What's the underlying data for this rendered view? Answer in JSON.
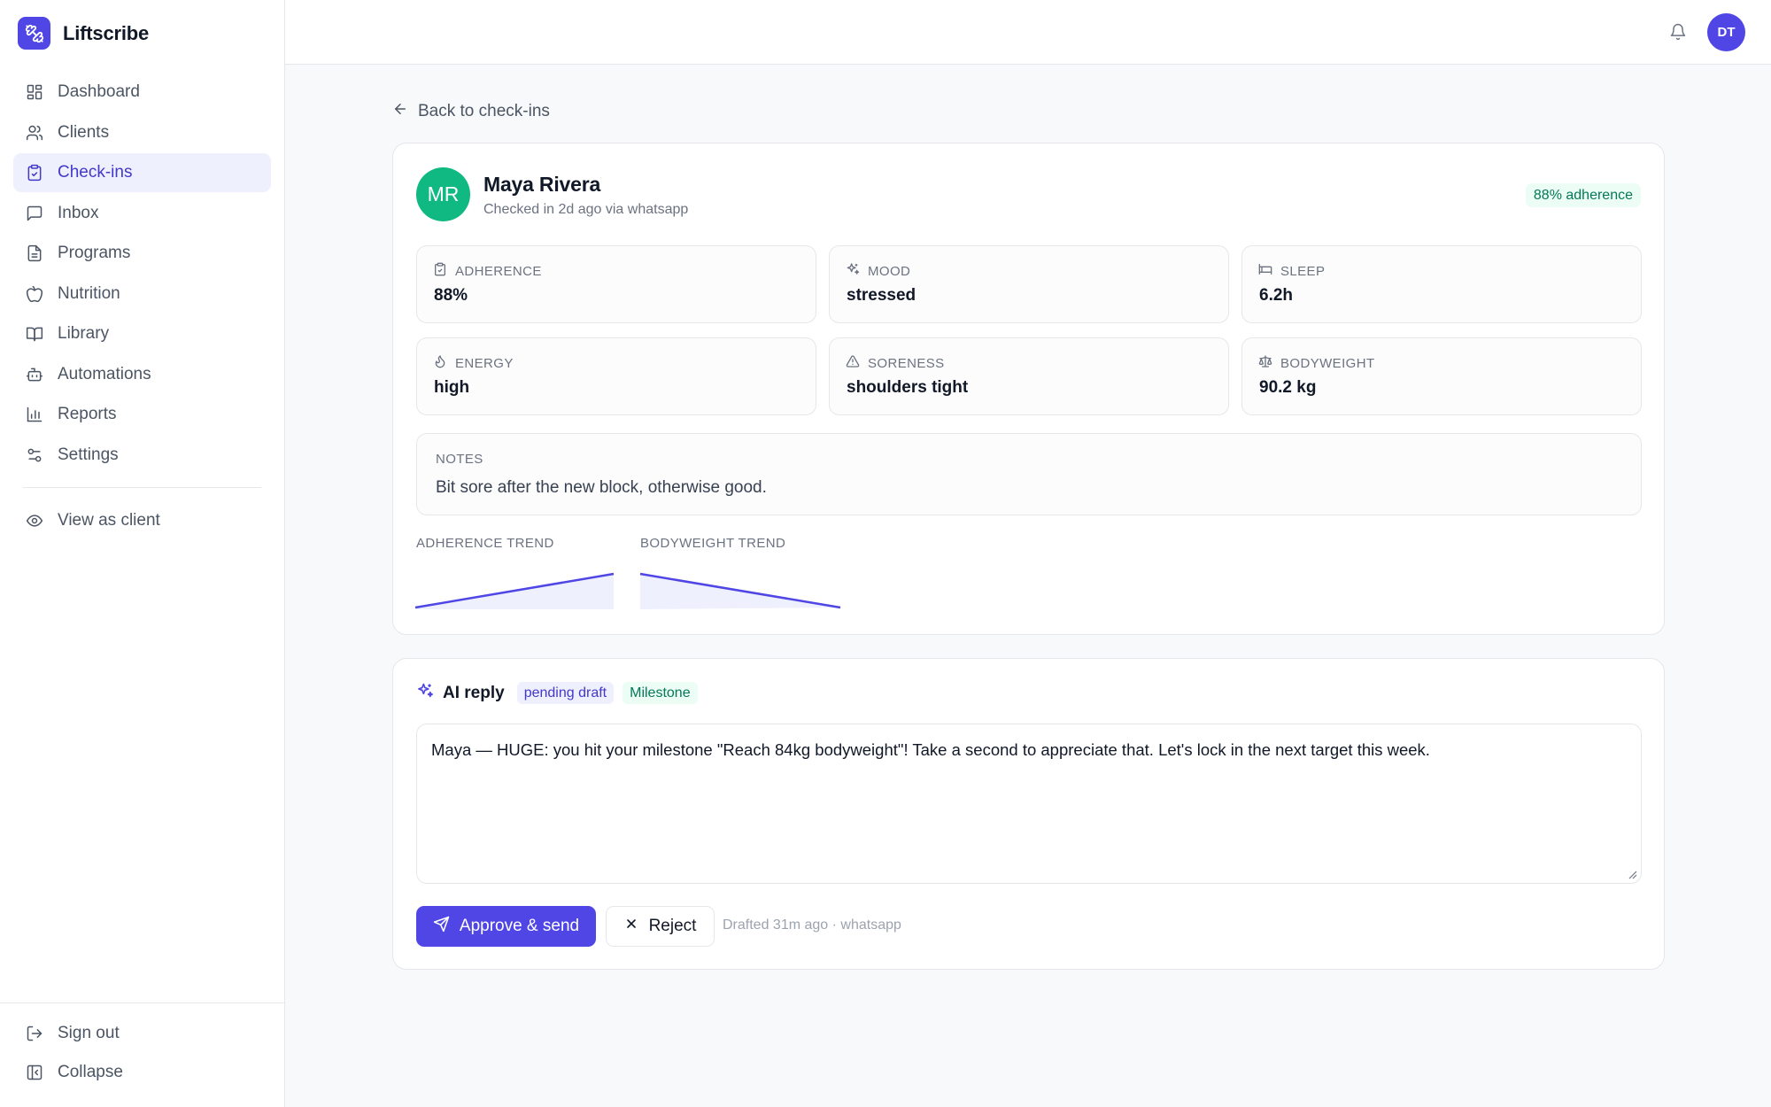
{
  "app": {
    "name": "Liftscribe"
  },
  "sidebar": {
    "items": [
      {
        "label": "Dashboard",
        "icon": "dashboard-icon"
      },
      {
        "label": "Clients",
        "icon": "users-icon"
      },
      {
        "label": "Check-ins",
        "icon": "clipboard-check-icon",
        "active": true
      },
      {
        "label": "Inbox",
        "icon": "message-icon"
      },
      {
        "label": "Programs",
        "icon": "document-icon"
      },
      {
        "label": "Nutrition",
        "icon": "apple-icon"
      },
      {
        "label": "Library",
        "icon": "book-icon"
      },
      {
        "label": "Automations",
        "icon": "bot-icon"
      },
      {
        "label": "Reports",
        "icon": "bar-chart-icon"
      },
      {
        "label": "Settings",
        "icon": "sliders-icon"
      }
    ],
    "view_as_client": "View as client",
    "sign_out": "Sign out",
    "collapse": "Collapse"
  },
  "header": {
    "user_initials": "DT"
  },
  "back_link": "Back to check-ins",
  "checkin": {
    "initials": "MR",
    "client_name": "Maya Rivera",
    "subtitle": "Checked in 2d ago via whatsapp",
    "adherence_badge": "88% adherence",
    "metrics": [
      {
        "label": "ADHERENCE",
        "value": "88%",
        "icon": "clipboard-icon"
      },
      {
        "label": "MOOD",
        "value": "stressed",
        "icon": "sparkles-icon"
      },
      {
        "label": "SLEEP",
        "value": "6.2h",
        "icon": "bed-icon"
      },
      {
        "label": "ENERGY",
        "value": "high",
        "icon": "flame-icon"
      },
      {
        "label": "SORENESS",
        "value": "shoulders tight",
        "icon": "warning-icon"
      },
      {
        "label": "BODYWEIGHT",
        "value": "90.2 kg",
        "icon": "scale-icon"
      }
    ],
    "notes_label": "NOTES",
    "notes": "Bit sore after the new block, otherwise good.",
    "adherence_trend_label": "ADHERENCE TREND",
    "bodyweight_trend_label": "BODYWEIGHT TREND",
    "colors": {
      "accent": "#4f46e5",
      "trend_fill": "#eef0fd",
      "avatar": "#10b981"
    }
  },
  "reply": {
    "title": "AI reply",
    "status": "pending draft",
    "tag": "Milestone",
    "message": "Maya — HUGE: you hit your milestone \"Reach 84kg bodyweight\"! Take a second to appreciate that. Let's lock in the next target this week.",
    "approve_label": "Approve & send",
    "reject_label": "Reject",
    "drafted_meta": "Drafted 31m ago · whatsapp"
  }
}
